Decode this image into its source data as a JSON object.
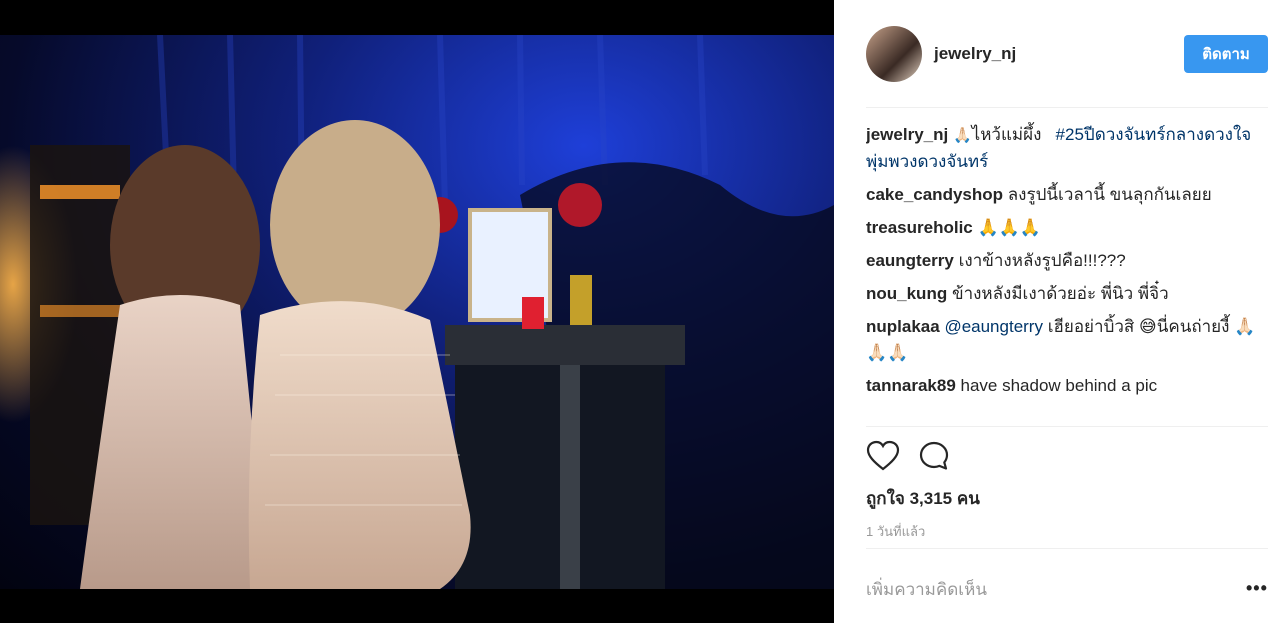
{
  "post": {
    "username": "jewelry_nj",
    "follow_label": "ติดตาม",
    "caption": {
      "emoji": "🙏🏻",
      "text": "ไหว้แม่ผึ้ง",
      "hashtag": "#25ปีดวงจันทร์กลางดวงใจพุ่มพวงดวงจันทร์"
    },
    "comments": [
      {
        "user": "cake_candyshop",
        "text": "ลงรูปนี้เวลานี้ ขนลุกกันเลยย"
      },
      {
        "user": "treasureholic",
        "text": "🙏🙏🙏"
      },
      {
        "user": "eaungterry",
        "text": "เงาข้างหลังรูปคือ!!!???"
      },
      {
        "user": "nou_kung",
        "text": "ข้างหลังมีเงาด้วยอ่ะ พี่นิว พี่จิ๋ว"
      },
      {
        "user": "nuplakaa",
        "mention": "@eaungterry",
        "text": "เฮียอย่าบิ้วสิ 😅นี่คนถ่ายงี้ 🙏🏻🙏🏻🙏🏻"
      },
      {
        "user": "tannarak89",
        "text": "have shadow behind a pic"
      }
    ],
    "likes_text": "ถูกใจ 3,315 คน",
    "time_text": "1 วันที่แล้ว",
    "add_comment_placeholder": "เพิ่มความคิดเห็น",
    "more_label": "•••"
  },
  "icons": {
    "like": "heart-icon",
    "comment": "comment-bubble-icon",
    "more": "ellipsis-icon"
  },
  "colors": {
    "follow_button": "#3897f0",
    "hashtag": "#003569",
    "muted": "#999999"
  }
}
